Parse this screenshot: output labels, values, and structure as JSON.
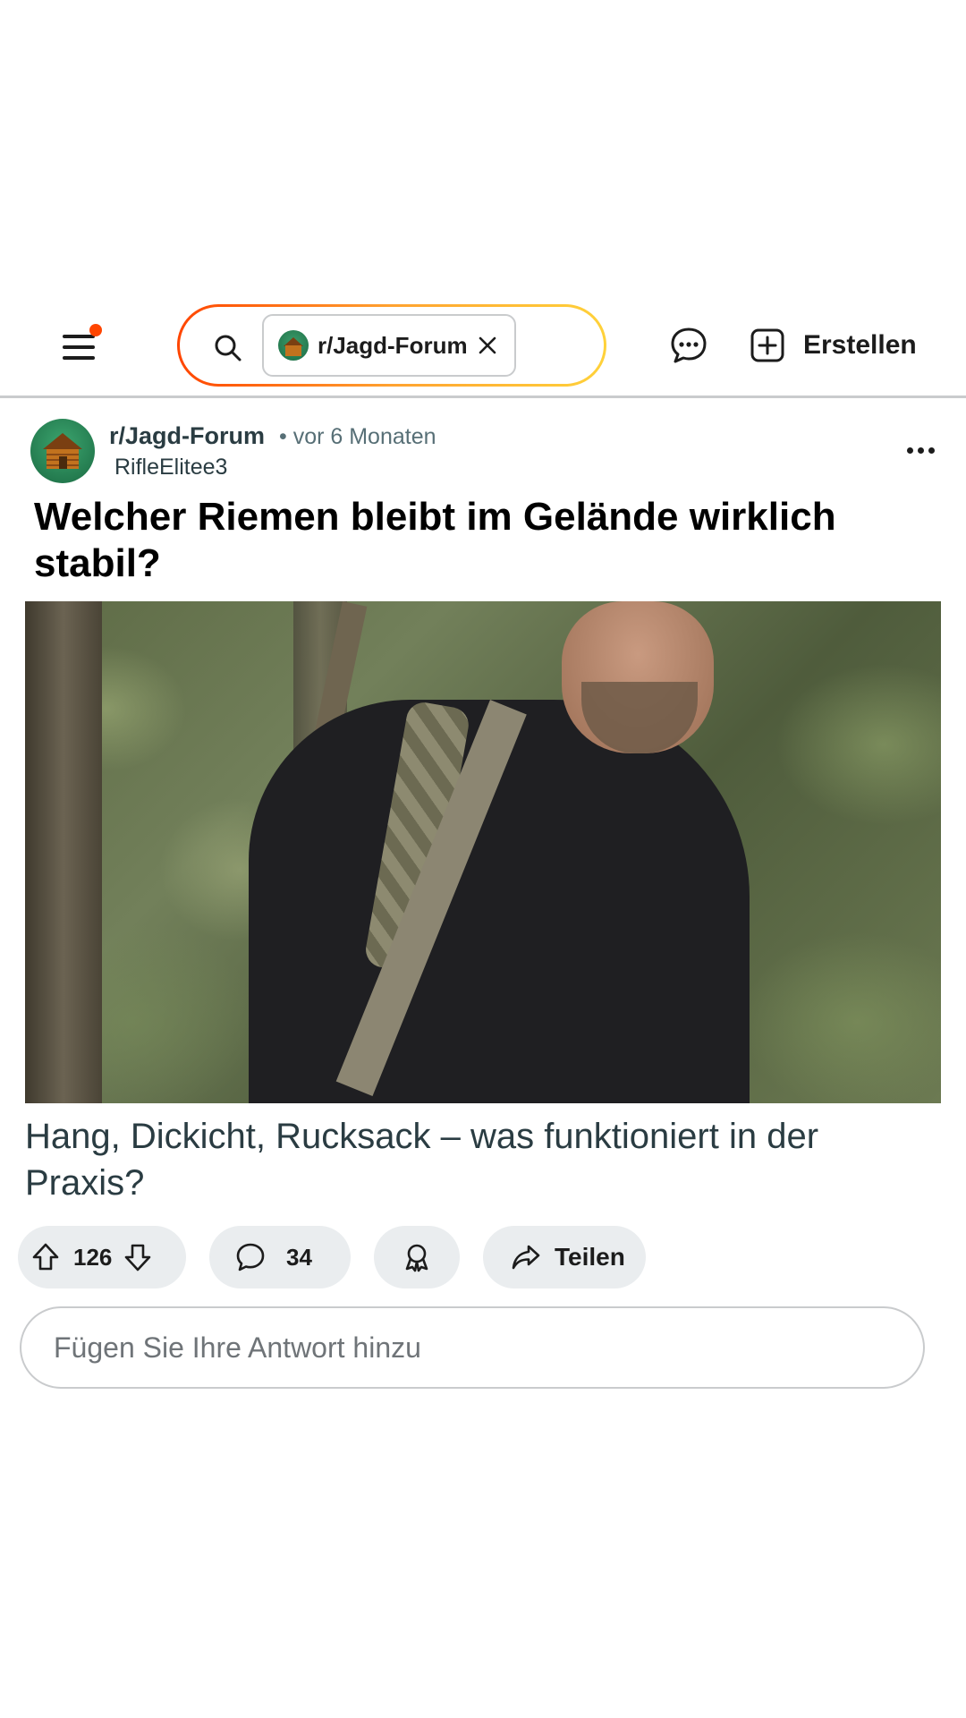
{
  "header": {
    "search_chip_label": "r/Jagd-Forum",
    "create_label": "Erstellen",
    "notification_dot_color": "#ff4500"
  },
  "post": {
    "subreddit": "r/Jagd-Forum",
    "time": "• vor 6 Monaten",
    "author": "RifleElitee3",
    "title": "Welcher Riemen bleibt im Gelände wirklich stabil?",
    "body": "Hang, Dickicht, Rucksack – was funktioniert in der Praxis?",
    "image_alt": "Jäger mit Rucksack und Gewehrriemen im Wald"
  },
  "actions": {
    "vote_count": "126",
    "comment_count": "34",
    "share_label": "Teilen"
  },
  "reply": {
    "placeholder": "Fügen Sie Ihre Antwort hinzu"
  },
  "icons": {
    "menu": "menu-icon",
    "search": "search-icon",
    "close": "close-icon",
    "chat": "chat-icon",
    "create": "plus-square-icon",
    "more": "more-horizontal-icon",
    "upvote": "upvote-icon",
    "downvote": "downvote-icon",
    "comment": "comment-icon",
    "award": "award-icon",
    "share": "share-icon"
  }
}
